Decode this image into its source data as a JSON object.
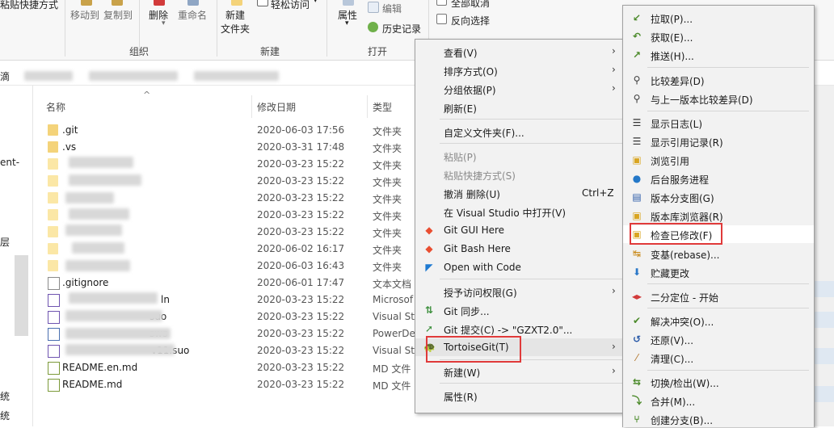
{
  "ribbon": {
    "paste_shortcut": "粘贴快捷方式",
    "move_to": "移动到",
    "copy_to": "复制到",
    "delete": "删除",
    "rename": "重命名",
    "new_folder_line1": "新建",
    "new_folder_line2": "文件夹",
    "easy_access": "轻松访问",
    "properties": "属性",
    "edit": "编辑",
    "history": "历史记录",
    "select_all": "全部取消",
    "invert_selection": "反向选择",
    "group_organize": "组织",
    "group_new": "新建",
    "group_open": "打开"
  },
  "address": {
    "prefix": "滴"
  },
  "nav": {
    "frag1": "ent-",
    "frag2": "层",
    "frag3": "统",
    "frag4": "统"
  },
  "list": {
    "col_name": "名称",
    "col_date": "修改日期",
    "col_type": "类型",
    "rows": [
      {
        "name": ".git",
        "date": "2020-06-03 17:56",
        "type": "文件夹",
        "icon": "folder-icon"
      },
      {
        "name": ".vs",
        "date": "2020-03-31 17:48",
        "type": "文件夹",
        "icon": "folder-icon"
      },
      {
        "name": "",
        "date": "2020-03-23 15:22",
        "type": "文件夹",
        "icon": "folder-icon"
      },
      {
        "name": "",
        "date": "2020-03-23 15:22",
        "type": "文件夹",
        "icon": "folder-icon"
      },
      {
        "name": "",
        "date": "2020-03-23 15:22",
        "type": "文件夹",
        "icon": "folder-icon"
      },
      {
        "name": "",
        "date": "2020-03-23 15:22",
        "type": "文件夹",
        "icon": "folder-icon"
      },
      {
        "name": "",
        "date": "2020-03-23 15:22",
        "type": "文件夹",
        "icon": "folder-icon"
      },
      {
        "name": "",
        "date": "2020-06-02 16:17",
        "type": "文件夹",
        "icon": "folder-icon"
      },
      {
        "name": "",
        "date": "2020-06-03 16:43",
        "type": "文件夹",
        "icon": "folder-icon"
      },
      {
        "name": ".gitignore",
        "date": "2020-06-01 17:47",
        "type": "文本文档",
        "icon": "text-file-icon"
      },
      {
        "name": "ln",
        "date": "2020-03-23 15:22",
        "type": "Microsof",
        "icon": "solution-file-icon"
      },
      {
        "name": "suo",
        "date": "2020-03-23 15:22",
        "type": "Visual Stu",
        "icon": "suo-file-icon"
      },
      {
        "name": "sws",
        "date": "2020-03-23 15:22",
        "type": "PowerDe",
        "icon": "powerdesigner-file-icon"
      },
      {
        "name": "v11.suo",
        "date": "2020-03-23 15:22",
        "type": "Visual Stu",
        "icon": "suo-file-icon"
      },
      {
        "name": "README.en.md",
        "date": "2020-03-23 15:22",
        "type": "MD 文件",
        "icon": "markdown-file-icon"
      },
      {
        "name": "README.md",
        "date": "2020-03-23 15:22",
        "type": "MD 文件",
        "icon": "markdown-file-icon"
      }
    ]
  },
  "context_menu": {
    "view": "查看(V)",
    "sort_by": "排序方式(O)",
    "group_by": "分组依据(P)",
    "refresh": "刷新(E)",
    "customize_folder": "自定义文件夹(F)...",
    "paste": "粘贴(P)",
    "paste_shortcut": "粘贴快捷方式(S)",
    "undo_delete": "撤消 删除(U)",
    "undo_shortcut": "Ctrl+Z",
    "open_in_vs": "在 Visual Studio 中打开(V)",
    "git_gui": "Git GUI Here",
    "git_bash": "Git Bash Here",
    "open_with_code": "Open with Code",
    "grant_access": "授予访问权限(G)",
    "git_sync": "Git 同步...",
    "git_commit": "Git 提交(C) -> \"GZXT2.0\"...",
    "tortoisegit": "TortoiseGit(T)",
    "new": "新建(W)",
    "properties": "属性(R)"
  },
  "submenu": {
    "pull": "拉取(P)...",
    "fetch": "获取(E)...",
    "push": "推送(H)...",
    "diff": "比较差异(D)",
    "diff_prev": "与上一版本比较差异(D)",
    "show_log": "显示日志(L)",
    "show_reflog": "显示引用记录(R)",
    "browse_refs": "浏览引用",
    "daemon": "后台服务进程",
    "revision_graph": "版本分支图(G)",
    "repo_browser": "版本库浏览器(R)",
    "check_modifications": "检查已修改(F)",
    "rebase": "变基(rebase)...",
    "stash": "贮藏更改",
    "bisect": "二分定位 - 开始",
    "resolve": "解决冲突(O)...",
    "revert": "还原(V)...",
    "cleanup": "清理(C)...",
    "switch": "切换/检出(W)...",
    "merge": "合并(M)...",
    "create_branch": "创建分支(B)..."
  },
  "colors": {
    "highlight_red": "#e03a3a",
    "menu_bg": "#f2f2f2",
    "folder": "#f4d37a"
  }
}
